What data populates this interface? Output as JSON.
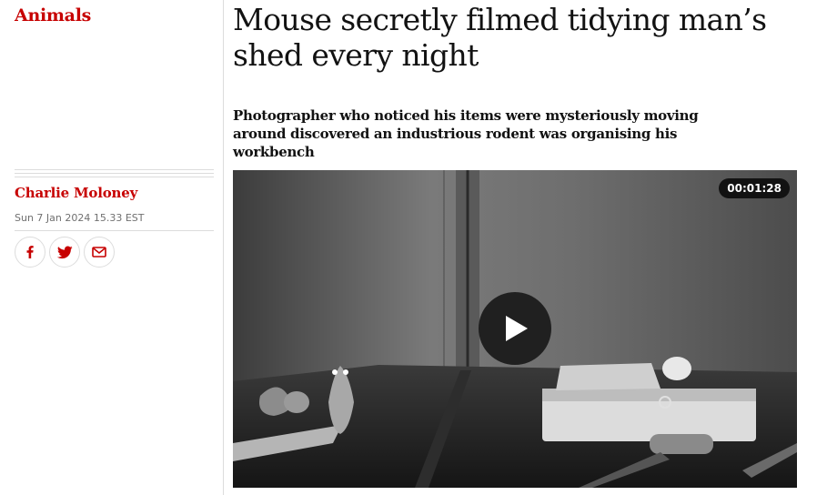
{
  "section": {
    "label": "Animals"
  },
  "byline": {
    "author": "Charlie Moloney",
    "date": "Sun 7 Jan 2024 15.33 EST"
  },
  "share": {
    "icons": [
      "facebook-icon",
      "twitter-icon",
      "email-icon"
    ]
  },
  "article": {
    "headline": "Mouse secretly filmed tidying man’s shed every night",
    "standfirst": "Photographer who noticed his items were mysteriously moving around discovered an industrious rodent was organising his workbench"
  },
  "video": {
    "duration": "00:01:28",
    "play_icon": "play-icon"
  },
  "colors": {
    "accent": "#c70000",
    "text": "#121212",
    "rule": "#dcdcdc",
    "meta": "#707070"
  }
}
